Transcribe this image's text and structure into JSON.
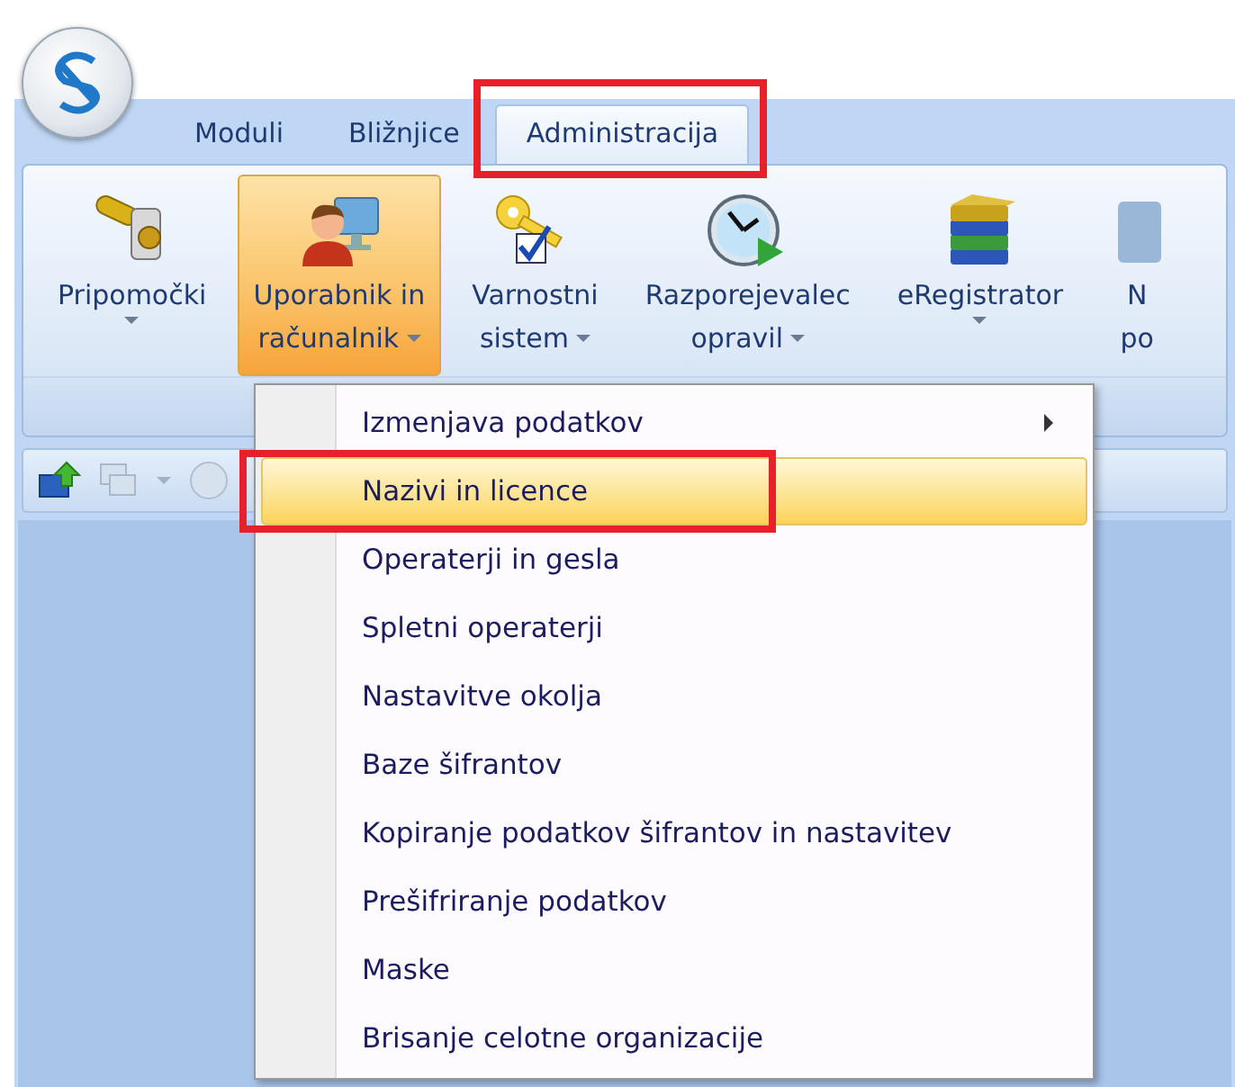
{
  "tabs": [
    {
      "label": "Moduli",
      "selected": false,
      "highlighted": false
    },
    {
      "label": "Bližnjice",
      "selected": false,
      "highlighted": false
    },
    {
      "label": "Administracija",
      "selected": true,
      "highlighted": true
    }
  ],
  "ribbon": {
    "buttons": [
      {
        "lines": [
          "Pripomočki"
        ],
        "dropdown": true,
        "selected": false
      },
      {
        "lines": [
          "Uporabnik in",
          "računalnik"
        ],
        "dropdown": true,
        "selected": true
      },
      {
        "lines": [
          "Varnostni",
          "sistem"
        ],
        "dropdown": true,
        "selected": false
      },
      {
        "lines": [
          "Razporejevalec",
          "opravil"
        ],
        "dropdown": true,
        "selected": false
      },
      {
        "lines": [
          "eRegistrator"
        ],
        "dropdown": true,
        "selected": false
      },
      {
        "lines": [
          "N",
          "po"
        ],
        "dropdown": false,
        "selected": false
      }
    ]
  },
  "menu": {
    "items": [
      {
        "label": "Izmenjava podatkov",
        "submenu": true,
        "selected": false,
        "highlighted": false
      },
      {
        "label": "Nazivi in licence",
        "submenu": false,
        "selected": true,
        "highlighted": true
      },
      {
        "label": "Operaterji in gesla",
        "submenu": false,
        "selected": false,
        "highlighted": false
      },
      {
        "label": "Spletni operaterji",
        "submenu": false,
        "selected": false,
        "highlighted": false
      },
      {
        "label": "Nastavitve okolja",
        "submenu": false,
        "selected": false,
        "highlighted": false
      },
      {
        "label": "Baze šifrantov",
        "submenu": false,
        "selected": false,
        "highlighted": false
      },
      {
        "label": "Kopiranje podatkov šifrantov in nastavitev",
        "submenu": false,
        "selected": false,
        "highlighted": false
      },
      {
        "label": "Prešifriranje podatkov",
        "submenu": false,
        "selected": false,
        "highlighted": false
      },
      {
        "label": "Maske",
        "submenu": false,
        "selected": false,
        "highlighted": false
      },
      {
        "label": "Brisanje celotne organizacije",
        "submenu": false,
        "selected": false,
        "highlighted": false
      }
    ]
  }
}
